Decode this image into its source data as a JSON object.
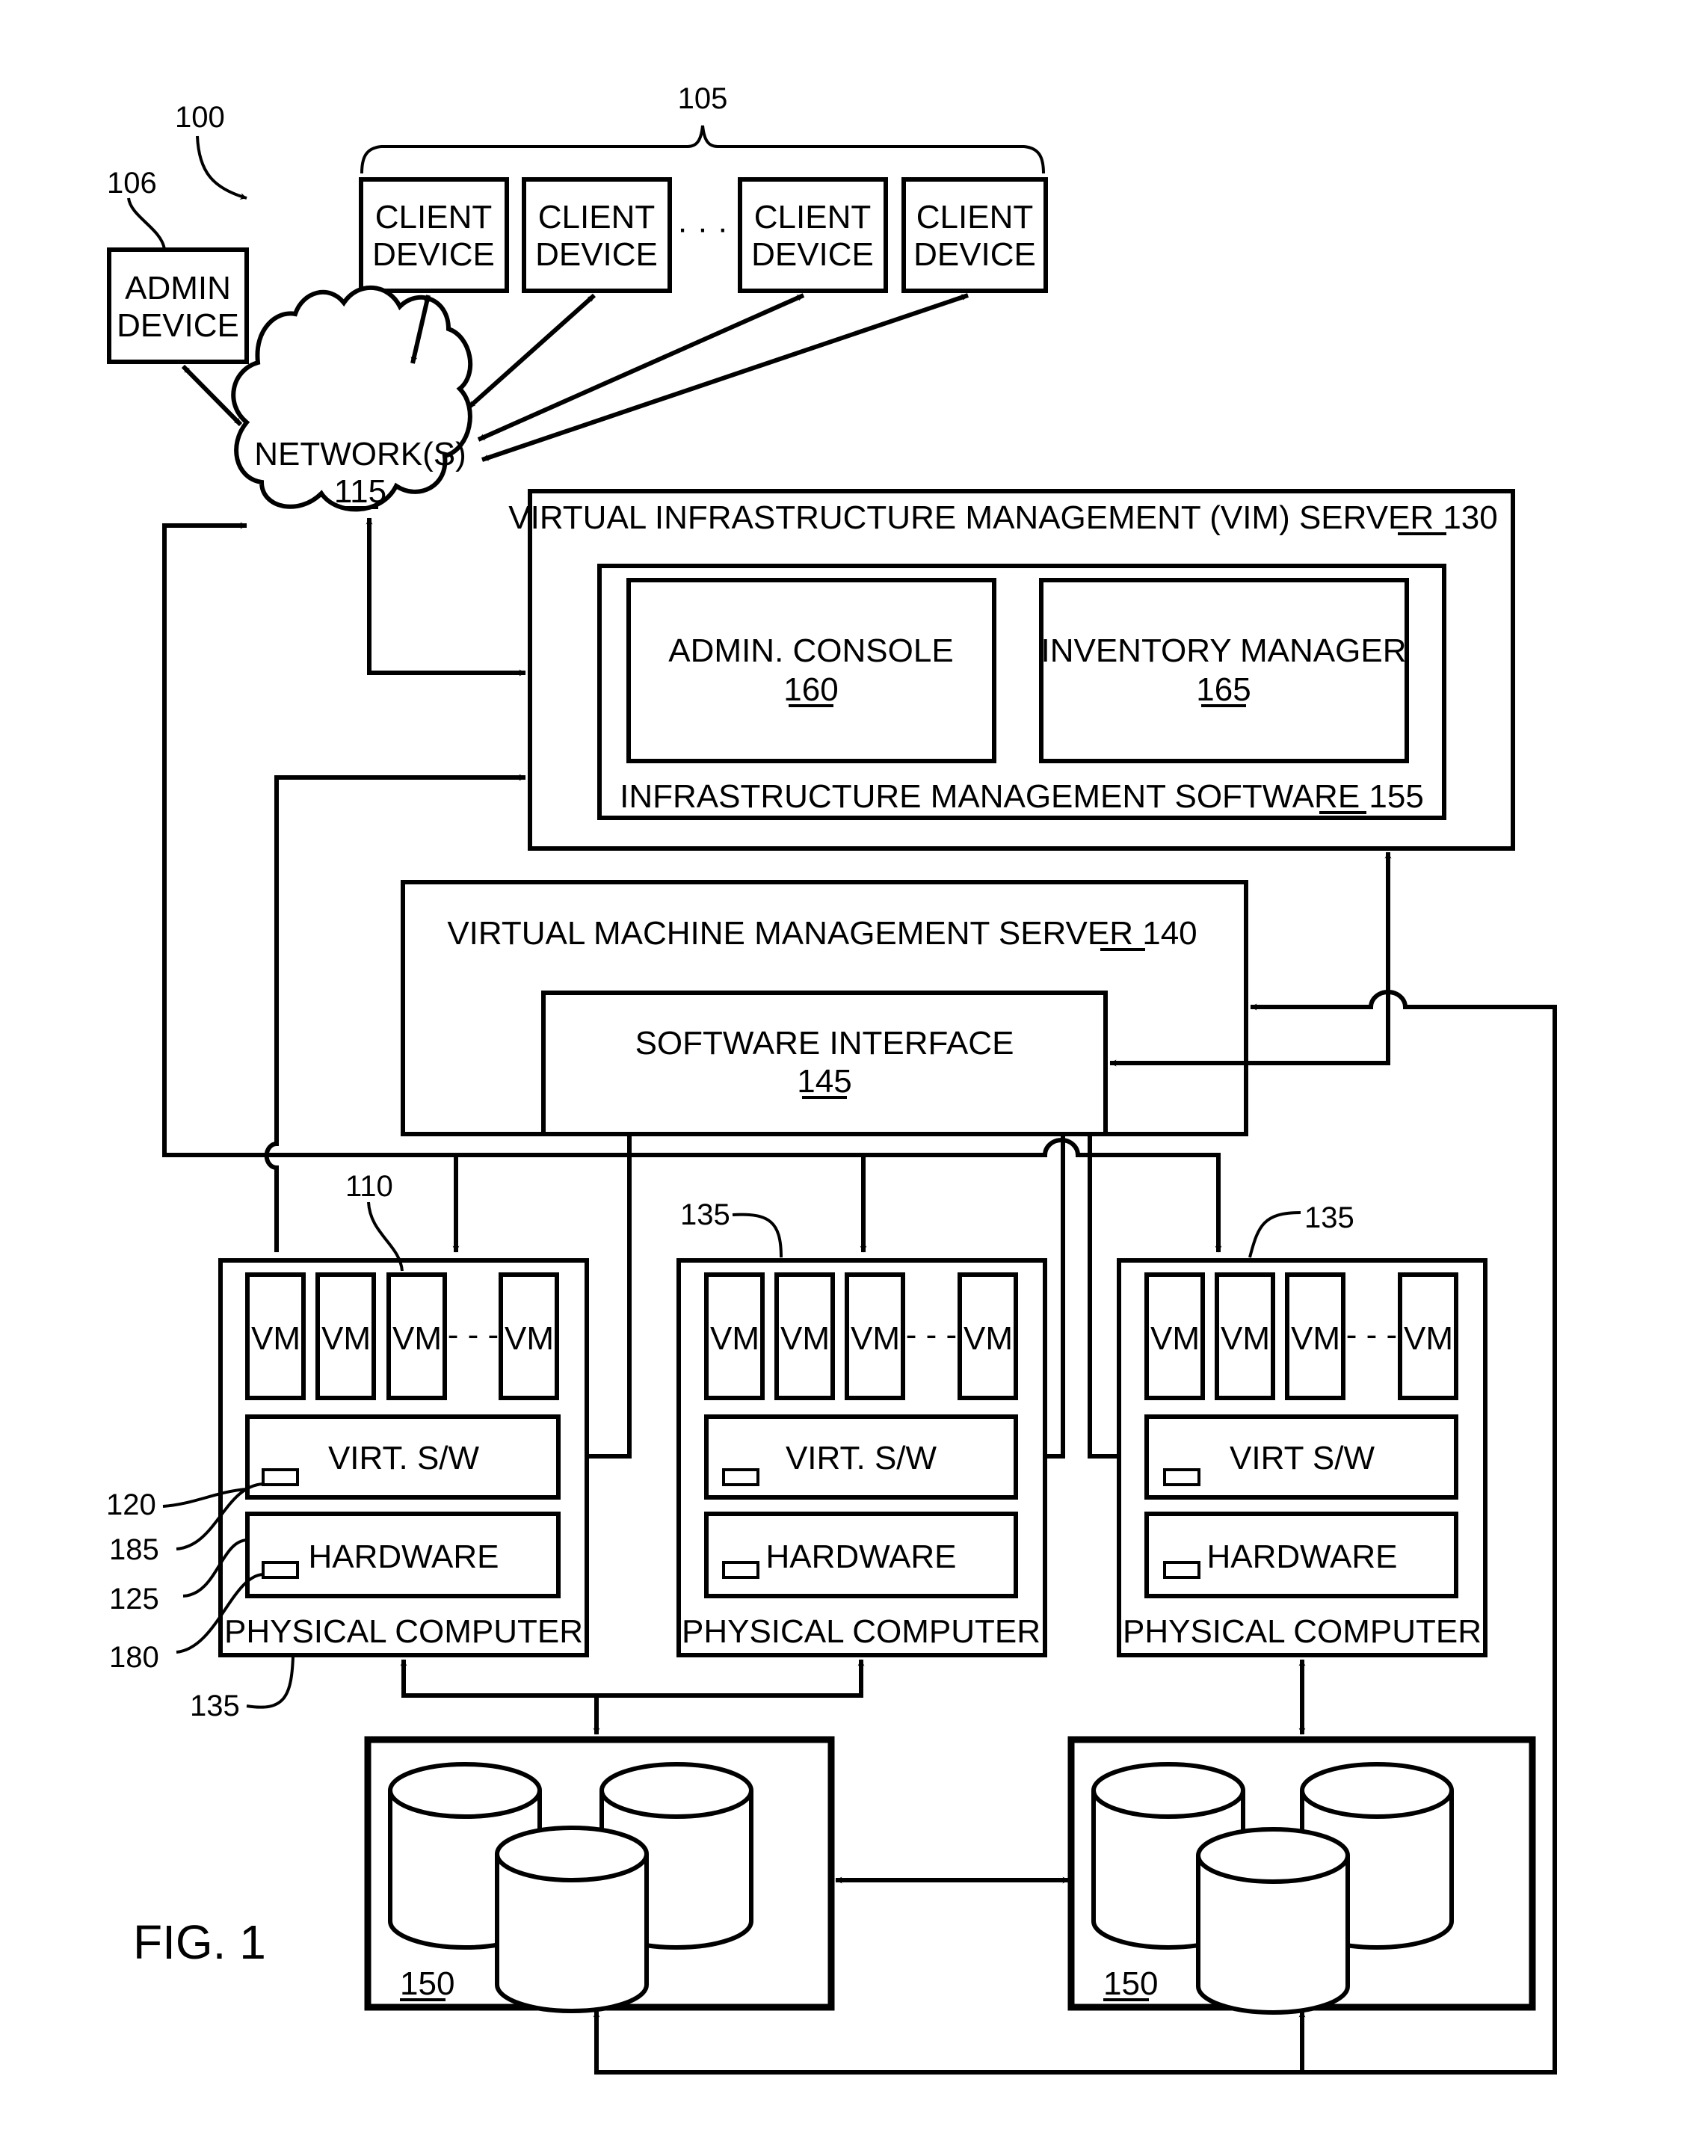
{
  "figure": {
    "caption": "FIG. 1",
    "system_ref": "100"
  },
  "colors": {
    "ink": "#000000",
    "paper": "#ffffff"
  },
  "admin_device": {
    "lines": [
      "ADMIN",
      "DEVICE"
    ],
    "ref": "106"
  },
  "client_devices": {
    "group_ref": "105",
    "items": [
      {
        "lines": [
          "CLIENT",
          "DEVICE"
        ]
      },
      {
        "lines": [
          "CLIENT",
          "DEVICE"
        ]
      },
      {
        "lines": [
          "CLIENT",
          "DEVICE"
        ]
      },
      {
        "lines": [
          "CLIENT",
          "DEVICE"
        ]
      }
    ],
    "ellipsis": "· · ·"
  },
  "network": {
    "label": "NETWORK(S)",
    "ref": "115"
  },
  "vim_server": {
    "label": "VIRTUAL INFRASTRUCTURE MANAGEMENT (VIM) SERVER",
    "ref": "130",
    "software": {
      "label": "INFRASTRUCTURE MANAGEMENT SOFTWARE",
      "ref": "155"
    },
    "admin_console": {
      "label": "ADMIN. CONSOLE",
      "ref": "160"
    },
    "inventory_manager": {
      "label": "INVENTORY MANAGER",
      "ref": "165"
    }
  },
  "vmm_server": {
    "label": "VIRTUAL MACHINE MANAGEMENT SERVER",
    "ref": "140",
    "software_interface": {
      "label": "SOFTWARE INTERFACE",
      "ref": "145"
    }
  },
  "physical_computers": [
    {
      "label": "PHYSICAL COMPUTER",
      "virt_label": "VIRT. S/W",
      "hw_label": "HARDWARE",
      "vm_label": "VM",
      "ref": "135"
    },
    {
      "label": "PHYSICAL COMPUTER",
      "virt_label": "VIRT. S/W",
      "hw_label": "HARDWARE",
      "vm_label": "VM",
      "ref": "135"
    },
    {
      "label": "PHYSICAL COMPUTER",
      "virt_label": "VIRT S/W",
      "hw_label": "HARDWARE",
      "vm_label": "VM",
      "ref": "135"
    }
  ],
  "vm_ellipsis": "- - -",
  "callouts": {
    "vm": "110",
    "virt_sw": "120",
    "virt_component": "185",
    "hardware": "125",
    "hw_component": "180"
  },
  "storage": [
    {
      "ref": "150"
    },
    {
      "ref": "150"
    }
  ]
}
